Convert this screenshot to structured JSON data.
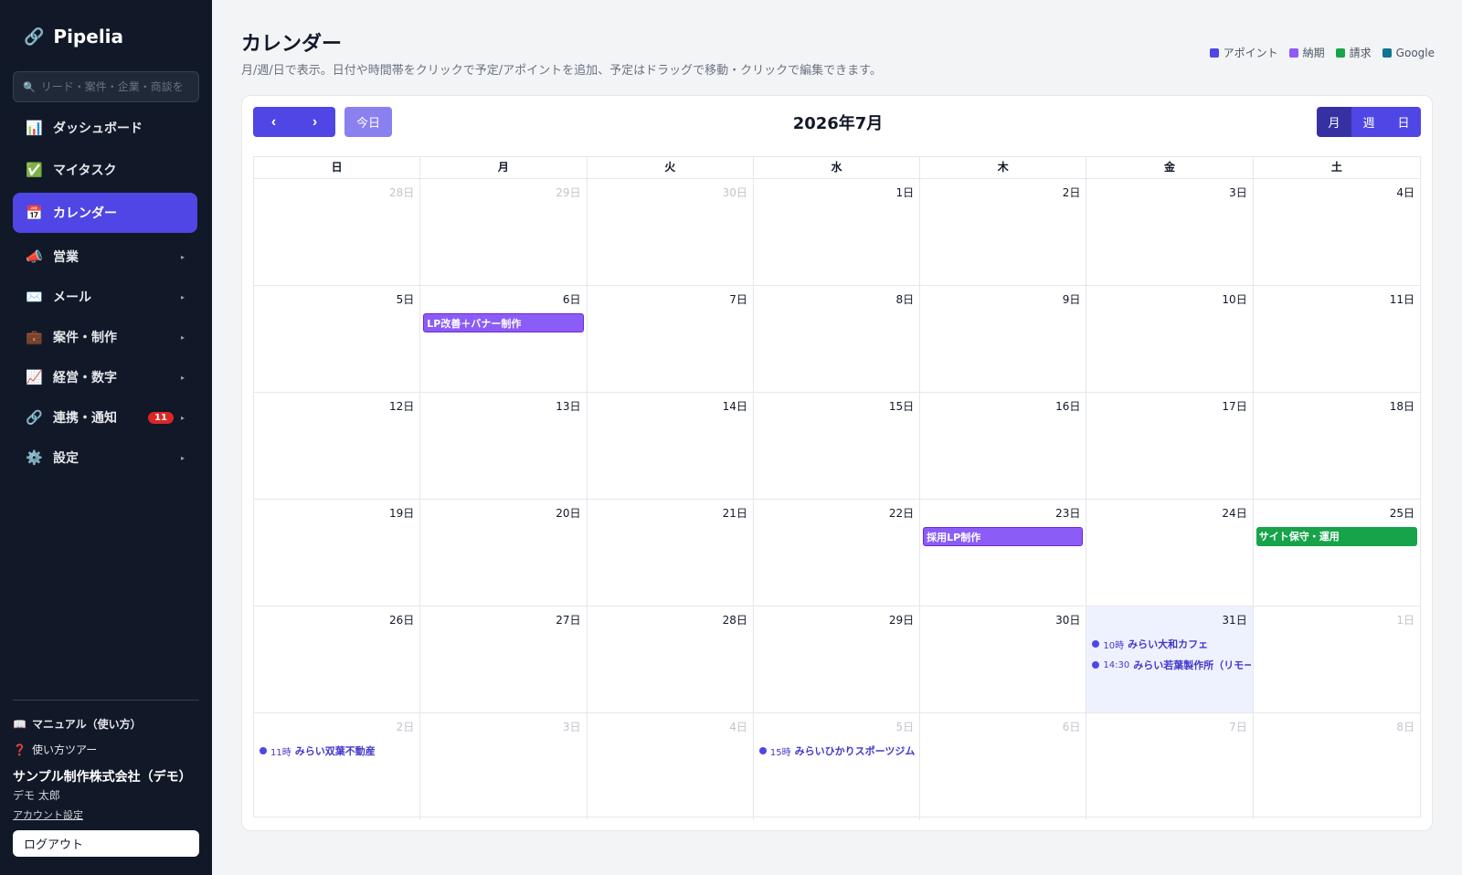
{
  "app": {
    "name": "Pipelia"
  },
  "sidebar": {
    "search_placeholder": "リード・案件・企業・商談を",
    "items": [
      {
        "label": "ダッシュボード",
        "icon": "bar-chart-icon"
      },
      {
        "label": "マイタスク",
        "icon": "check-box-icon"
      },
      {
        "label": "カレンダー",
        "icon": "calendar-icon",
        "active": true
      },
      {
        "label": "営業",
        "icon": "megaphone-icon"
      },
      {
        "label": "メール",
        "icon": "envelope-icon"
      },
      {
        "label": "案件・制作",
        "icon": "briefcase-icon"
      },
      {
        "label": "経営・数字",
        "icon": "line-chart-icon"
      },
      {
        "label": "連携・通知",
        "icon": "link-icon",
        "badge": "11"
      },
      {
        "label": "設定",
        "icon": "gear-icon"
      }
    ],
    "manual": "マニュアル（使い方）",
    "tour": "使い方ツアー",
    "company": "サンプル制作株式会社（デモ）",
    "user": "デモ 太郎",
    "account": "アカウント設定",
    "logout": "ログアウト"
  },
  "header": {
    "title": "カレンダー",
    "subtitle": "月/週/日で表示。日付や時間帯をクリックで予定/アポイントを追加、予定はドラッグで移動・クリックで編集できます。"
  },
  "legend": [
    {
      "label": "アポイント",
      "color": "#4f46e5"
    },
    {
      "label": "納期",
      "color": "#8b5cf6"
    },
    {
      "label": "請求",
      "color": "#16a34a"
    },
    {
      "label": "Google",
      "color": "#0e7490"
    }
  ],
  "toolbar": {
    "prev": "‹",
    "next": "›",
    "today": "今日",
    "title": "2026年7月",
    "views": [
      "月",
      "週",
      "日"
    ],
    "active_view": "月"
  },
  "calendar": {
    "weekdays": [
      "日",
      "月",
      "火",
      "水",
      "木",
      "金",
      "土"
    ],
    "weeks": [
      [
        {
          "label": "28日",
          "other": true
        },
        {
          "label": "29日",
          "other": true
        },
        {
          "label": "30日",
          "other": true
        },
        {
          "label": "1日"
        },
        {
          "label": "2日"
        },
        {
          "label": "3日"
        },
        {
          "label": "4日"
        }
      ],
      [
        {
          "label": "5日"
        },
        {
          "label": "6日",
          "bar": {
            "title": "LP改善＋バナー制作",
            "type": "purple"
          }
        },
        {
          "label": "7日"
        },
        {
          "label": "8日"
        },
        {
          "label": "9日"
        },
        {
          "label": "10日"
        },
        {
          "label": "11日"
        }
      ],
      [
        {
          "label": "12日"
        },
        {
          "label": "13日"
        },
        {
          "label": "14日"
        },
        {
          "label": "15日"
        },
        {
          "label": "16日"
        },
        {
          "label": "17日"
        },
        {
          "label": "18日"
        }
      ],
      [
        {
          "label": "19日"
        },
        {
          "label": "20日"
        },
        {
          "label": "21日"
        },
        {
          "label": "22日"
        },
        {
          "label": "23日",
          "bar": {
            "title": "採用LP制作",
            "type": "purple"
          }
        },
        {
          "label": "24日"
        },
        {
          "label": "25日",
          "bar": {
            "title": "サイト保守・運用",
            "type": "green"
          }
        }
      ],
      [
        {
          "label": "26日"
        },
        {
          "label": "27日"
        },
        {
          "label": "28日"
        },
        {
          "label": "29日"
        },
        {
          "label": "30日"
        },
        {
          "label": "31日",
          "today": true,
          "events": [
            {
              "time": "10時",
              "name": "みらい大和カフェ"
            },
            {
              "time": "14:30",
              "name": "みらい若葉製作所（リモート）"
            }
          ]
        },
        {
          "label": "1日",
          "other": true
        }
      ],
      [
        {
          "label": "2日",
          "other": true,
          "events": [
            {
              "time": "11時",
              "name": "みらい双葉不動産"
            }
          ]
        },
        {
          "label": "3日",
          "other": true
        },
        {
          "label": "4日",
          "other": true
        },
        {
          "label": "5日",
          "other": true,
          "events": [
            {
              "time": "15時",
              "name": "みらいひかりスポーツジム"
            }
          ]
        },
        {
          "label": "6日",
          "other": true
        },
        {
          "label": "7日",
          "other": true
        },
        {
          "label": "8日",
          "other": true
        }
      ]
    ]
  }
}
